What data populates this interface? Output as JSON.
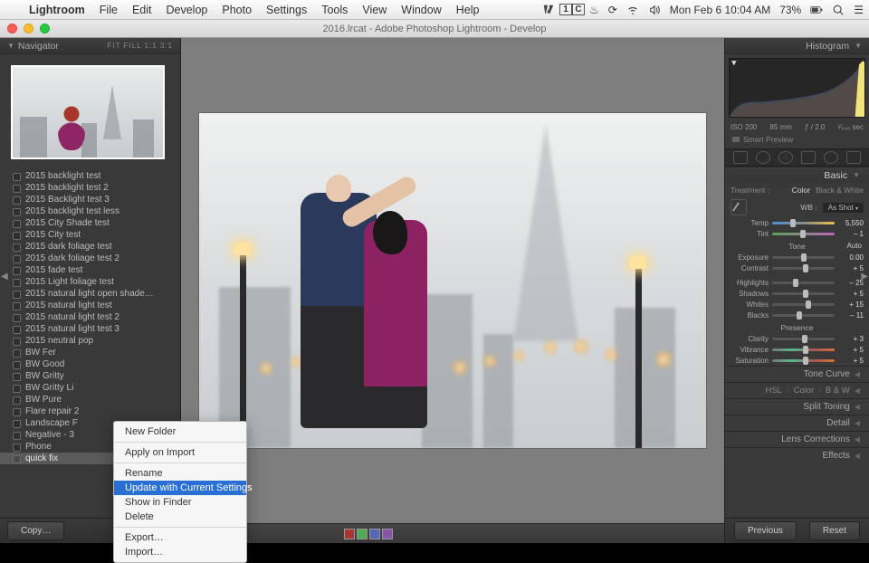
{
  "mac_menu": {
    "app_name": "Lightroom",
    "items": [
      "File",
      "Edit",
      "Develop",
      "Photo",
      "Settings",
      "Tools",
      "View",
      "Window",
      "Help"
    ],
    "clock": "Mon Feb 6  10:04 AM",
    "battery": "73%"
  },
  "window": {
    "title": "2016.lrcat - Adobe Photoshop Lightroom - Develop"
  },
  "navigator": {
    "title": "Navigator",
    "zoom_opts": "FIT   FILL   1:1   3:1"
  },
  "presets": [
    "2015 backlight test",
    "2015 backlight test 2",
    "2015 Backlight test 3",
    "2015 backlight test less",
    "2015 City Shade test",
    "2015 City test",
    "2015 dark foliage test",
    "2015 dark foliage test 2",
    "2015 fade test",
    "2015 Light foliage test",
    "2015 natural light open shade…",
    "2015 natural light test",
    "2015 natural light test 2",
    "2015 natural light test 3",
    "2015 neutral pop",
    "BW Fer",
    "BW Good",
    "BW Gritty",
    "BW Gritty Li",
    "BW Pure",
    "Flare repair 2",
    "Landscape F",
    "Negative - 3",
    "Phone",
    "quick fix"
  ],
  "preset_selected_index": 24,
  "left_bottom": {
    "copy": "Copy…"
  },
  "context_menu": {
    "items_top": [
      "New Folder"
    ],
    "items_mid": [
      "Apply on Import"
    ],
    "items_rename": [
      "Rename",
      "Update with Current Settings",
      "Show in Finder",
      "Delete"
    ],
    "items_export": [
      "Export…",
      "Import…"
    ],
    "highlight_index": 1
  },
  "histogram": {
    "title": "Histogram",
    "iso": "ISO 200",
    "focal": "85 mm",
    "aperture": "ƒ / 2.0",
    "shutter": "¹⁄₆₄₀ sec",
    "smart_preview": "Smart Preview"
  },
  "basic": {
    "title": "Basic",
    "treatment_label": "Treatment :",
    "color": "Color",
    "bw": "Black & White",
    "wb_label": "WB :",
    "wb_value": "As Shot",
    "temp_label": "Temp",
    "temp_val": "5,550",
    "tint_label": "Tint",
    "tint_val": "– 1",
    "tone_label": "Tone",
    "auto": "Auto",
    "exposure_label": "Exposure",
    "exposure_val": "0.00",
    "contrast_label": "Contrast",
    "contrast_val": "+ 5",
    "highlights_label": "Highlights",
    "highlights_val": "– 25",
    "shadows_label": "Shadows",
    "shadows_val": "+ 5",
    "whites_label": "Whites",
    "whites_val": "+ 15",
    "blacks_label": "Blacks",
    "blacks_val": "– 11",
    "presence_label": "Presence",
    "clarity_label": "Clarity",
    "clarity_val": "+ 3",
    "vibrance_label": "Vibrance",
    "vibrance_val": "+ 5",
    "saturation_label": "Saturation",
    "saturation_val": "+ 5"
  },
  "sections": {
    "tone_curve": "Tone Curve",
    "hsl": "HSL",
    "hsl_color": "Color",
    "hsl_bw": "B & W",
    "split": "Split Toning",
    "detail": "Detail",
    "lens": "Lens Corrections",
    "effects": "Effects"
  },
  "right_bottom": {
    "previous": "Previous",
    "reset": "Reset"
  }
}
